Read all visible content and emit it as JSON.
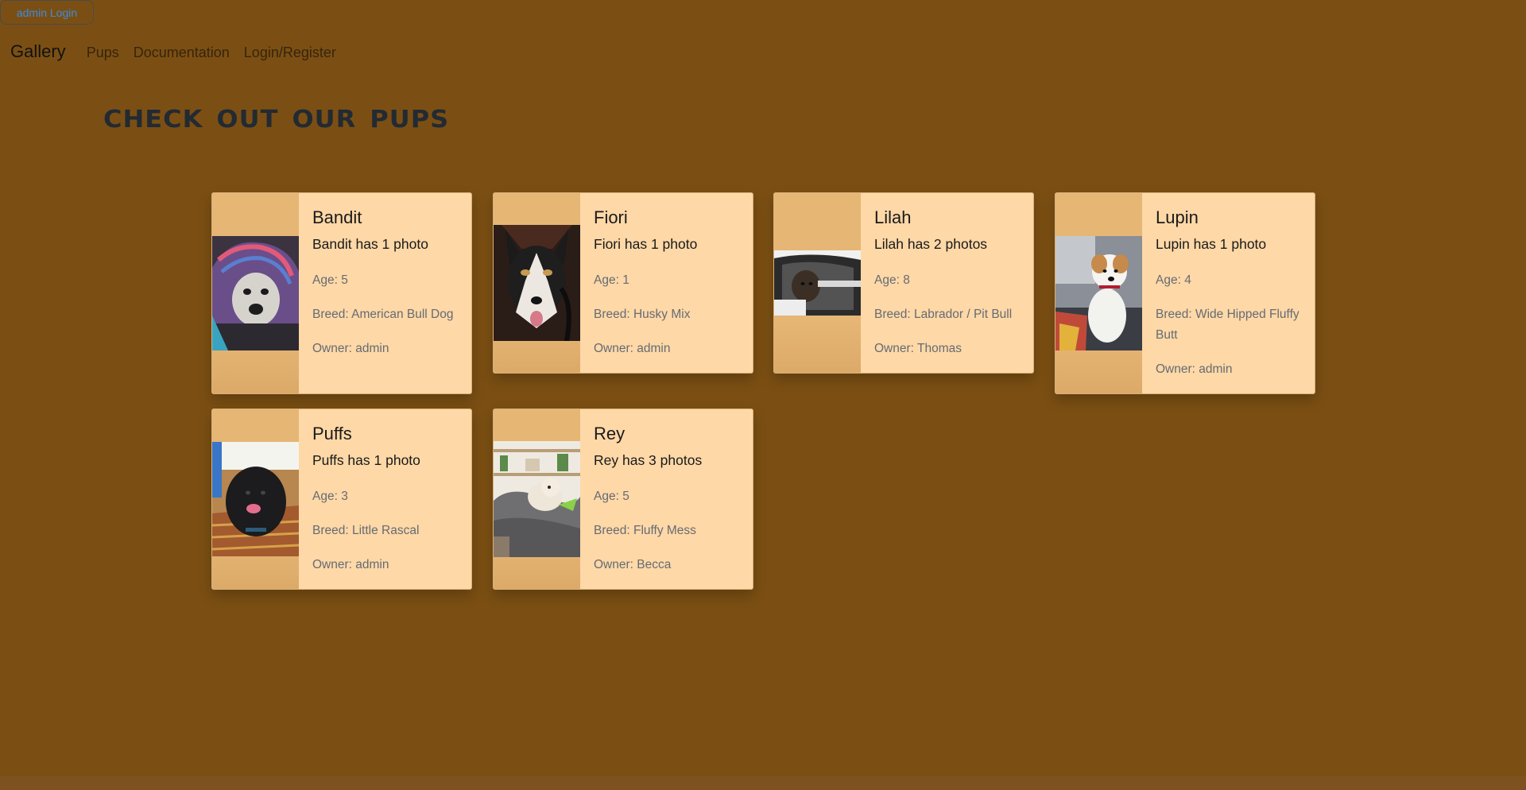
{
  "admin_button": "admin Login",
  "nav": {
    "brand": "Gallery",
    "links": [
      "Pups",
      "Documentation",
      "Login/Register"
    ]
  },
  "page_title": "Check out our Pups",
  "pups": [
    {
      "name": "Bandit",
      "photos": "Bandit has 1 photo",
      "age": "Age: 5",
      "breed": "Breed: American Bull Dog",
      "owner": "Owner: admin"
    },
    {
      "name": "Fiori",
      "photos": "Fiori has 1 photo",
      "age": "Age: 1",
      "breed": "Breed: Husky Mix",
      "owner": "Owner: admin"
    },
    {
      "name": "Lilah",
      "photos": "Lilah has 2 photos",
      "age": "Age: 8",
      "breed": "Breed: Labrador / Pit Bull",
      "owner": "Owner: Thomas"
    },
    {
      "name": "Lupin",
      "photos": "Lupin has 1 photo",
      "age": "Age: 4",
      "breed": "Breed: Wide Hipped Fluffy Butt",
      "owner": "Owner: admin"
    },
    {
      "name": "Puffs",
      "photos": "Puffs has 1 photo",
      "age": "Age: 3",
      "breed": "Breed: Little Rascal",
      "owner": "Owner: admin"
    },
    {
      "name": "Rey",
      "photos": "Rey has 3 photos",
      "age": "Age: 5",
      "breed": "Breed: Fluffy Mess",
      "owner": "Owner: Becca"
    }
  ],
  "colors": {
    "background": "#7b4f13",
    "card": "#fed8a7",
    "link_blue": "#3d8be0"
  }
}
